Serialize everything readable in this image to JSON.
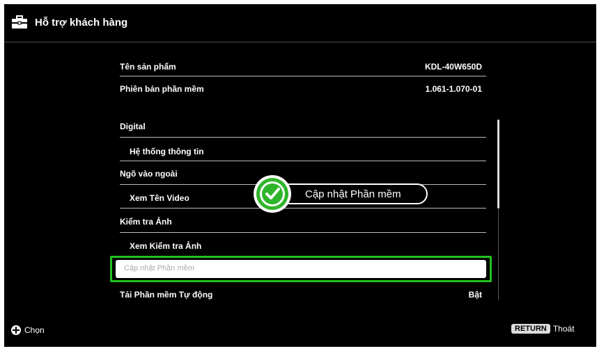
{
  "header": {
    "title": "Hỗ trợ khách hàng",
    "icon": "toolbox-icon"
  },
  "info_rows": [
    {
      "label": "Tên sản phẩm",
      "value": "KDL-40W650D"
    },
    {
      "label": "Phiên bản phần mềm",
      "value": "1.061-1.070-01"
    }
  ],
  "menu_rows": [
    {
      "label": "Digital"
    },
    {
      "label": "Hệ thống thông tin"
    },
    {
      "label": "Ngõ vào ngoài"
    },
    {
      "label": "Xem Tên Video"
    },
    {
      "label": "Kiểm tra Ảnh"
    },
    {
      "label": "Xem Kiểm tra Ảnh"
    }
  ],
  "selected_row": {
    "label": "Cập nhật Phần mềm"
  },
  "auto_row": {
    "label": "Tải Phần mềm Tự động",
    "value": "Bật"
  },
  "toast": {
    "text": "Cập nhật Phần mềm",
    "icon": "check-icon"
  },
  "footer": {
    "select_label": "Chọn",
    "return_button": "RETURN",
    "exit_label": "Thoát"
  },
  "colors": {
    "highlight": "#22c21e",
    "background": "#000000",
    "text": "#ffffff"
  }
}
